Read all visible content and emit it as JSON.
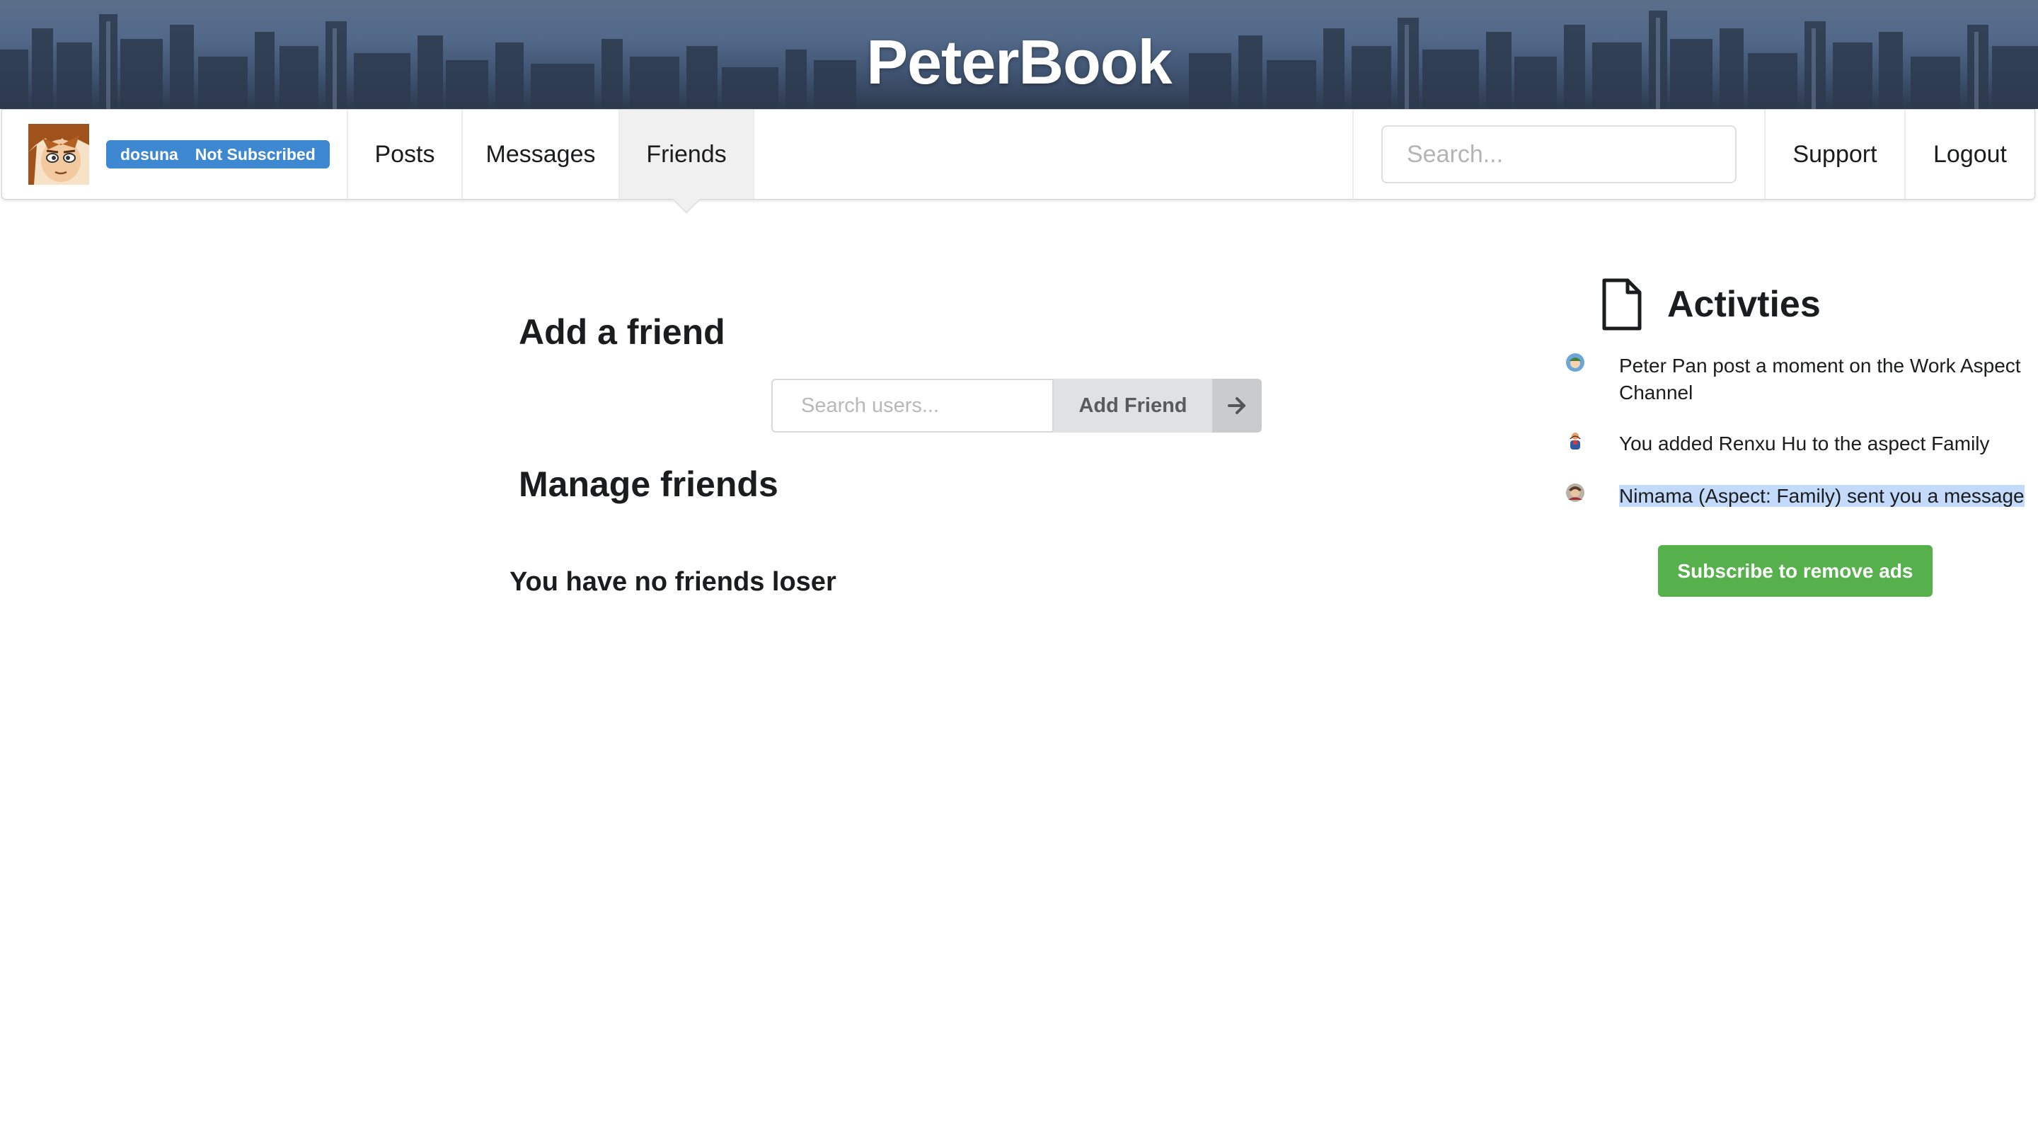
{
  "banner": {
    "title": "PeterBook"
  },
  "user": {
    "username": "dosuna",
    "subscription": "Not Subscribed",
    "avatar_icon": "user-avatar"
  },
  "nav": {
    "posts": "Posts",
    "messages": "Messages",
    "friends": "Friends",
    "active": "Friends",
    "search_placeholder": "Search...",
    "support": "Support",
    "logout": "Logout"
  },
  "main": {
    "add_heading": "Add a friend",
    "user_search_placeholder": "Search users...",
    "add_button": "Add Friend",
    "manage_heading": "Manage friends",
    "empty_message": "You have no friends loser"
  },
  "activities": {
    "title": "Activties",
    "items": [
      {
        "text": "Peter Pan post a moment on the Work Aspect Channel",
        "icon": "user-avatar-small"
      },
      {
        "text": "You added Renxu Hu to the aspect Family",
        "icon": "user-avatar-small"
      },
      {
        "text": "Nimama (Aspect: Family) sent you a message",
        "icon": "user-avatar-small",
        "highlighted": true
      }
    ],
    "subscribe_button": "Subscribe to remove ads"
  },
  "colors": {
    "badge": "#3d88d0",
    "subscribe": "#56b14d",
    "active_tab": "#f0f0f0",
    "highlight": "#c3dafb"
  }
}
